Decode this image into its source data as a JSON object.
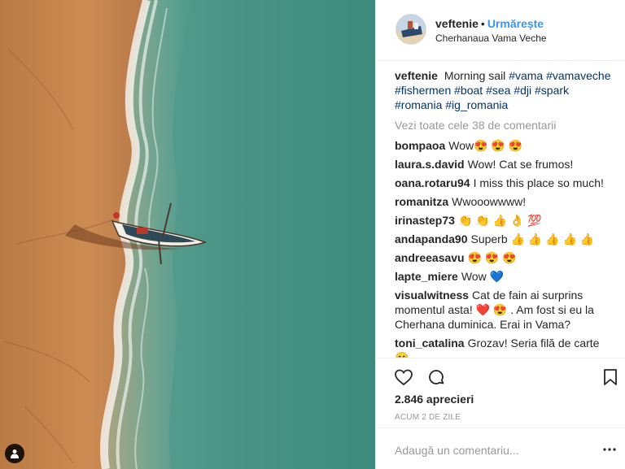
{
  "header": {
    "username": "veftenie",
    "separator": "•",
    "follow_label": "Urmărește",
    "location": "Cherhanaua Vama Veche",
    "avatar_icon": "avatar-image"
  },
  "caption": {
    "username": "veftenie",
    "text": "Morning sail",
    "hashtags": "#vama #vamaveche #fishermen #boat #sea #dji #spark #romania #ig_romania"
  },
  "view_all": "Vezi toate cele 38 de comentarii",
  "comments": [
    {
      "user": "bompaoa",
      "text": "Wow😍 😍 😍"
    },
    {
      "user": "laura.s.david",
      "text": "Wow! Cat se frumos!"
    },
    {
      "user": "oana.rotaru94",
      "text": "I miss this place so much!"
    },
    {
      "user": "romanitza",
      "text": "Wwooowwww!"
    },
    {
      "user": "irinastep73",
      "text": "👏 👏 👍 👌 💯"
    },
    {
      "user": "andapanda90",
      "text": "Superb 👍 👍 👍 👍 👍"
    },
    {
      "user": "andreeasavu",
      "text": "😍 😍 😍"
    },
    {
      "user": "lapte_miere",
      "text": "Wow 💙"
    },
    {
      "user": "visualwitness",
      "text": "Cat de fain ai surprins momentul asta! ❤️ 😍 . Am fost si eu la Cherhana duminica. Erai in Vama?"
    },
    {
      "user": "toni_catalina",
      "text": "Grozav! Seria filă de carte 😊"
    }
  ],
  "actions": {
    "like_icon": "heart-icon",
    "comment_icon": "comment-icon",
    "save_icon": "bookmark-icon"
  },
  "likes": "2.846 aprecieri",
  "timestamp": "Acum 2 de zile",
  "add_comment": {
    "placeholder": "Adaugă un comentariu...",
    "more_icon": "more-icon"
  },
  "colors": {
    "follow": "#3897f0",
    "hashtag": "#003569",
    "muted": "#999999",
    "sand": "#c98a4f",
    "sea": "#4f9a8c"
  }
}
